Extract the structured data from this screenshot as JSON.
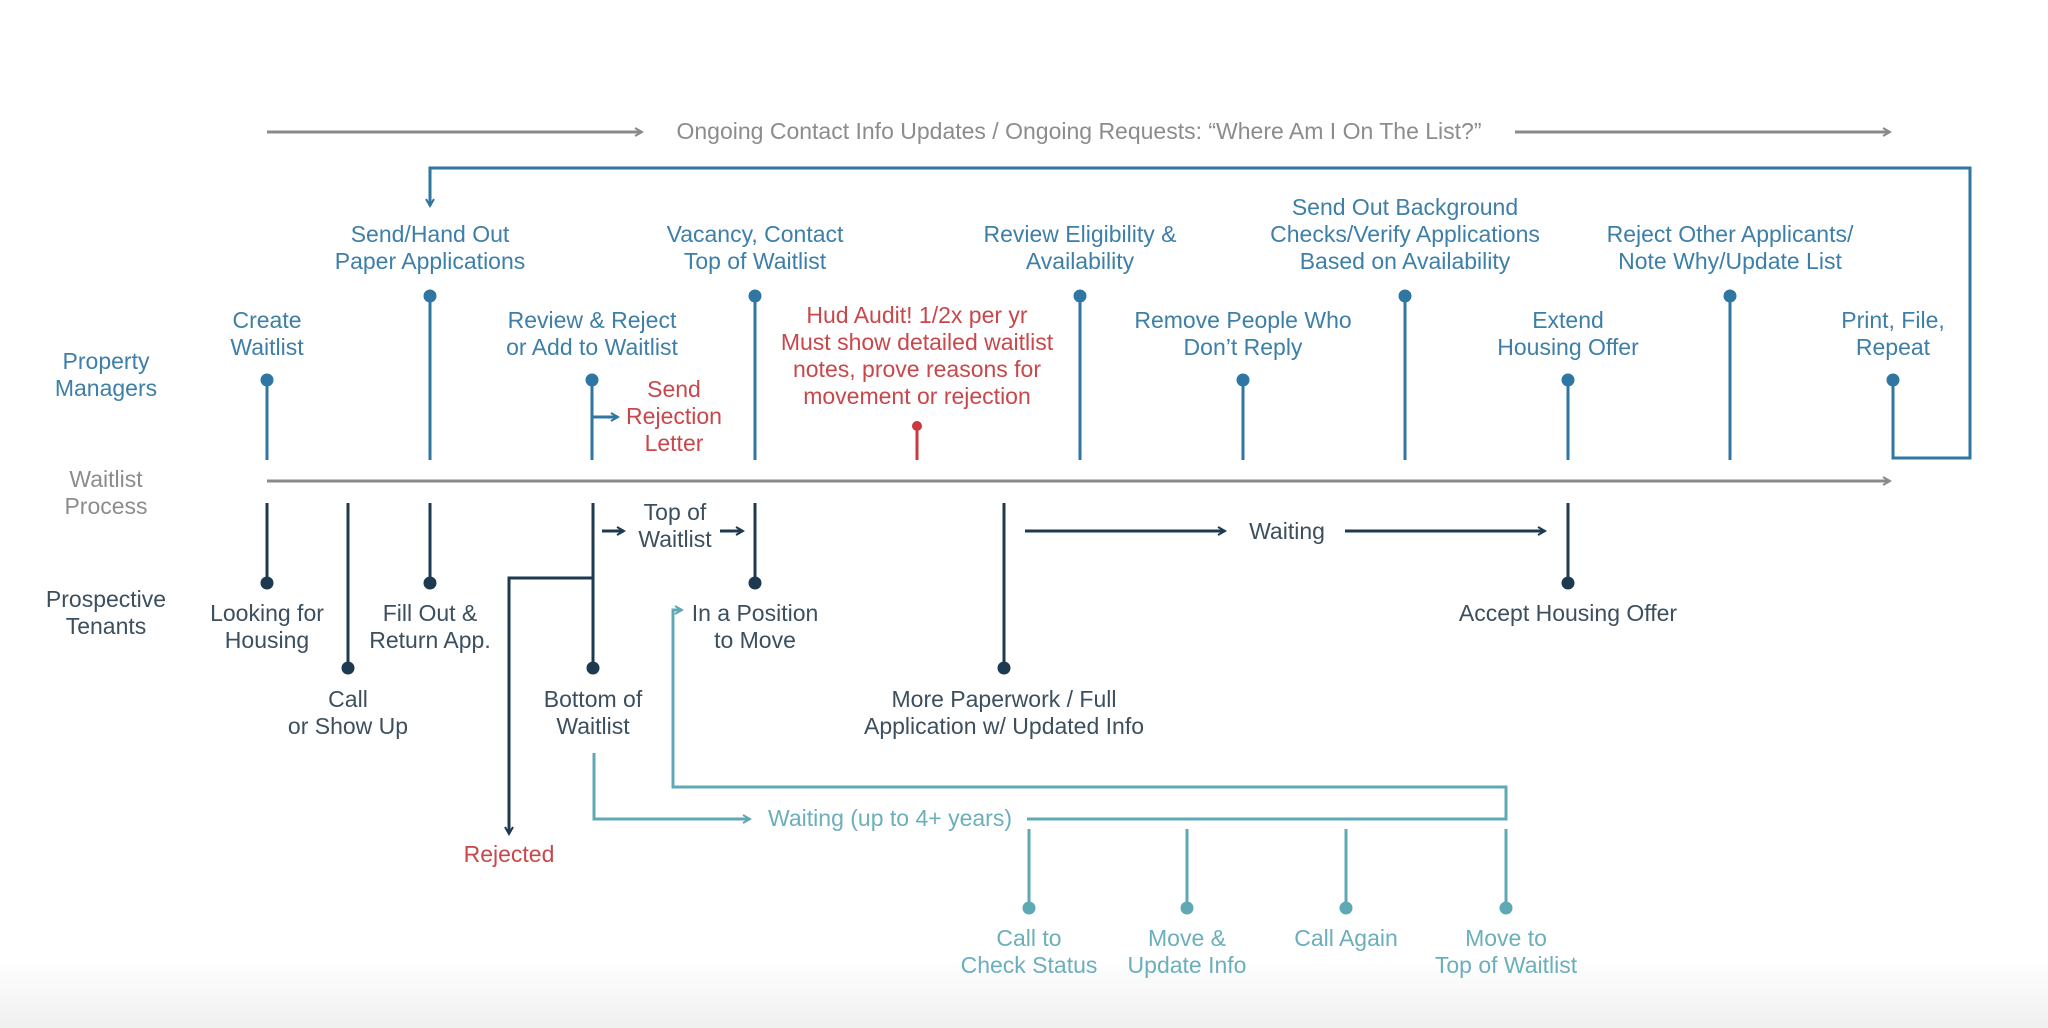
{
  "colors": {
    "manager": "#2f76a3",
    "tenant": "#1d3a50",
    "teal": "#5fa9b7",
    "red": "#c9393f",
    "gray": "#8a8a8a"
  },
  "banner": {
    "text": "Ongoing Contact Info Updates / Ongoing Requests: “Where Am I On The List?”"
  },
  "lanes": {
    "property_managers": "Property\nManagers",
    "waitlist_process": "Waitlist\nProcess",
    "prospective_tenants": "Prospective\nTenants"
  },
  "manager_steps": [
    {
      "id": "create-waitlist",
      "label": "Create\nWaitlist"
    },
    {
      "id": "send-paper-applications",
      "label": "Send/Hand Out\nPaper Applications"
    },
    {
      "id": "review-reject-add",
      "label": "Review & Reject\nor Add to Waitlist"
    },
    {
      "id": "vacancy-contact-top",
      "label": "Vacancy, Contact\nTop of Waitlist"
    },
    {
      "id": "review-eligibility",
      "label": "Review Eligibility &\nAvailability"
    },
    {
      "id": "remove-no-reply",
      "label": "Remove People Who\nDon’t Reply"
    },
    {
      "id": "background-checks",
      "label": "Send Out Background\nChecks/Verify Applications\nBased on Availability"
    },
    {
      "id": "extend-offer",
      "label": "Extend\nHousing Offer"
    },
    {
      "id": "reject-others",
      "label": "Reject Other Applicants/\nNote Why/Update List"
    },
    {
      "id": "print-file-repeat",
      "label": "Print, File,\nRepeat"
    }
  ],
  "send_rejection_letter": "Send\nRejection\nLetter",
  "hud_audit": "Hud Audit! 1/2x per yr\nMust show detailed waitlist\nnotes, prove reasons for\nmovement or rejection",
  "tenant_steps": [
    {
      "id": "looking-for-housing",
      "label": "Looking for\nHousing"
    },
    {
      "id": "call-or-show-up",
      "label": "Call\nor Show Up"
    },
    {
      "id": "fill-out-return",
      "label": "Fill Out &\nReturn App."
    },
    {
      "id": "top-of-waitlist",
      "label": "Top of\nWaitlist"
    },
    {
      "id": "bottom-of-waitlist",
      "label": "Bottom of\nWaitlist"
    },
    {
      "id": "in-position-to-move",
      "label": "In a Position\nto Move"
    },
    {
      "id": "more-paperwork",
      "label": "More Paperwork / Full\nApplication w/ Updated Info"
    },
    {
      "id": "waiting",
      "label": "Waiting"
    },
    {
      "id": "accept-housing-offer",
      "label": "Accept Housing Offer"
    }
  ],
  "rejected": "Rejected",
  "waiting_long": "Waiting (up to 4+ years)",
  "waiting_steps": [
    {
      "id": "call-check-status",
      "label": "Call to\nCheck Status"
    },
    {
      "id": "move-update-info",
      "label": "Move &\nUpdate Info"
    },
    {
      "id": "call-again",
      "label": "Call Again"
    },
    {
      "id": "move-to-top",
      "label": "Move to\nTop of Waitlist"
    }
  ]
}
